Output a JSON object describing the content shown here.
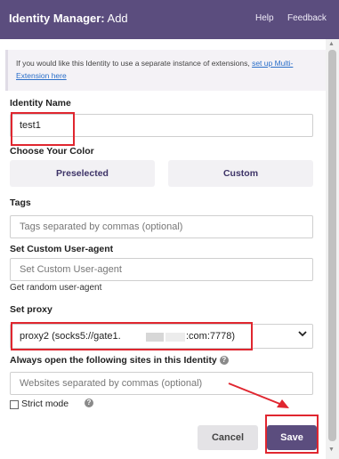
{
  "header": {
    "app_name": "Identity Manager",
    "separator": ":",
    "mode": " Add",
    "help_label": "Help",
    "feedback_label": "Feedback",
    "background_color": "#5b4d7e"
  },
  "info": {
    "text": "If you would like this Identity to use a separate instance of extensions, ",
    "link_text": "set up Multi-Extension here"
  },
  "form": {
    "identity_name_label": "Identity Name",
    "identity_name_value": "test1",
    "color_label": "Choose Your Color",
    "color_options": [
      "Preselected",
      "Custom"
    ],
    "tags_label": "Tags",
    "tags_placeholder": "Tags separated by commas (optional)",
    "user_agent_label": "Set Custom User-agent",
    "user_agent_placeholder": "Set Custom User-agent",
    "random_user_agent_link": "Get random user-agent",
    "proxy_label": "Set proxy",
    "proxy_value_prefix": "proxy2 (socks5://gate1.",
    "proxy_value_suffix": ":com:7778)",
    "sites_label": "Always open the following sites in this Identity",
    "sites_placeholder": "Websites separated by commas (optional)",
    "strict_mode_label": "Strict mode",
    "strict_mode_checked": false
  },
  "buttons": {
    "cancel": "Cancel",
    "save": "Save"
  },
  "icons": {
    "help": "question-circle-icon",
    "dropdown": "chevron-down-icon",
    "annotation_color": "#e0262f"
  }
}
